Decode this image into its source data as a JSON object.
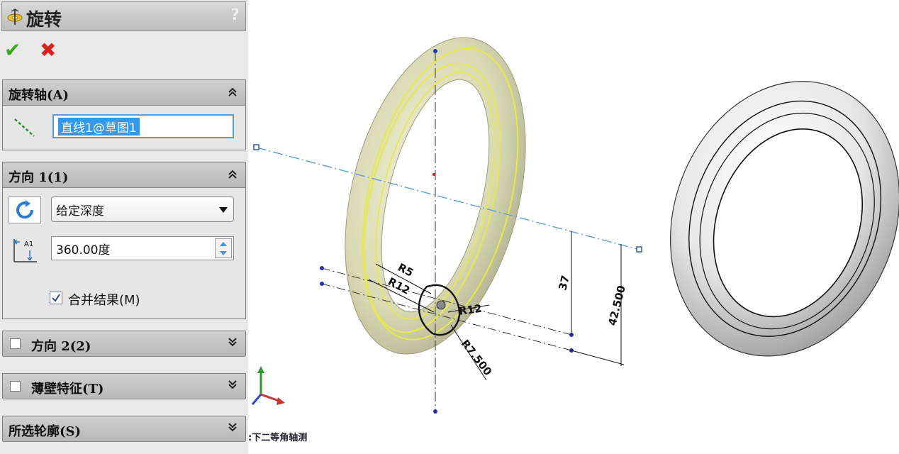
{
  "feature": {
    "title": "旋转",
    "help_label": "?",
    "ok_symbol": "✔",
    "cancel_symbol": "✖"
  },
  "groups": {
    "axis": {
      "title": "旋转轴(A)",
      "value": "直线1@草图1",
      "chevron": "≈"
    },
    "direction1": {
      "title": "方向 1(1)",
      "end_condition": "给定深度",
      "angle": "360.00度",
      "angle_icon_label": "A1",
      "merge_checkbox_label": "合并结果(M)",
      "merge_checked": true
    },
    "direction2": {
      "title": "方向 2(2)",
      "checked": false
    },
    "thin": {
      "title": "薄壁特征(T)",
      "checked": false
    },
    "contours": {
      "title": "所选轮廓(S)"
    }
  },
  "viewport": {
    "view_label": ":下二等角轴测",
    "dimensions": [
      "R5",
      "R12",
      "R12",
      "R7.500",
      "37",
      "42.500"
    ]
  },
  "colors": {
    "accent_selection": "#3399ee",
    "ok_green": "#3aa81e",
    "cancel_red": "#d8231f",
    "preview_yellow": "#e8e84a",
    "axis_line": "#5aa0d8"
  }
}
